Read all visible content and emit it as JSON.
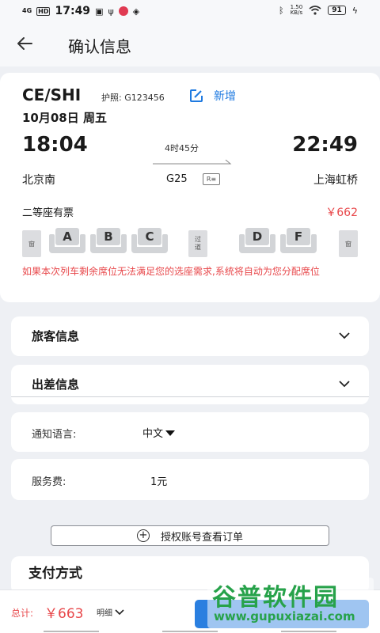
{
  "status_bar": {
    "signal": "4G",
    "hd": "HD",
    "time": "17:49",
    "speed": "1.50",
    "speed_unit": "KB/s",
    "battery": "91"
  },
  "nav": {
    "title": "确认信息",
    "back_icon": "arrow-left-icon"
  },
  "ticket": {
    "passenger": "CE/SHI",
    "passport": "护照: G123456",
    "add_label": "新增",
    "date": "10月08日 周五",
    "depart_time": "18:04",
    "arrive_time": "22:49",
    "duration": "4时45分",
    "from_station": "北京南",
    "to_station": "上海虹桥",
    "train_no": "G25",
    "seat_class": "二等座有票",
    "price": "￥662",
    "seats": {
      "window_left": "窗",
      "a": "A",
      "b": "B",
      "c": "C",
      "aisle": "过道",
      "d": "D",
      "f": "F",
      "window_right": "窗"
    },
    "note": "如果本次列车剩余席位无法满足您的选座需求,系统将自动为您分配席位"
  },
  "sections": {
    "passenger_info": "旅客信息",
    "travel_info": "出差信息"
  },
  "notify": {
    "label": "通知语言:",
    "value": "中文"
  },
  "service_fee": {
    "label": "服务费:",
    "value": "1元"
  },
  "auth_button": "授权账号查看订单",
  "payment": {
    "title": "支付方式"
  },
  "bottom": {
    "total_label": "总计:",
    "total_value": "￥663",
    "detail": "明细"
  },
  "watermark": {
    "name": "谷普软件园",
    "url": "www.gupuxiazai.com"
  },
  "colors": {
    "accent": "#1f7ae0",
    "price_red": "#e8484b",
    "watermark_green": "#27a24a"
  }
}
